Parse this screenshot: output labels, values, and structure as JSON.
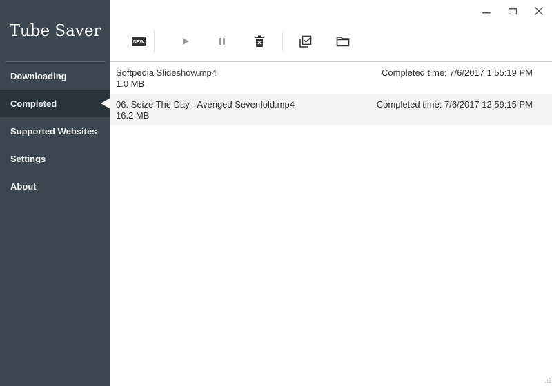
{
  "app": {
    "title": "Tube Saver"
  },
  "window_controls": {
    "minimize": "minimize",
    "maximize": "maximize",
    "close": "close"
  },
  "sidebar": {
    "active": "Completed",
    "items": [
      {
        "label": "Downloading"
      },
      {
        "label": "Completed"
      },
      {
        "label": "Supported Websites"
      },
      {
        "label": "Settings"
      },
      {
        "label": "About"
      }
    ]
  },
  "toolbar": {
    "buttons": [
      {
        "name": "new",
        "icon": "new-badge-icon",
        "label": "NEW",
        "enabled": true
      },
      {
        "name": "start",
        "icon": "play-icon",
        "enabled": false
      },
      {
        "name": "pause",
        "icon": "pause-icon",
        "enabled": false
      },
      {
        "name": "delete",
        "icon": "trash-icon",
        "enabled": true
      },
      {
        "name": "select-all",
        "icon": "select-all-icon",
        "enabled": true
      },
      {
        "name": "open-folder",
        "icon": "folder-icon",
        "enabled": true
      }
    ]
  },
  "downloads": [
    {
      "name": "Softpedia Slideshow.mp4",
      "size": "1.0 MB",
      "completed_time": "Completed time: 7/6/2017 1:55:19 PM"
    },
    {
      "name": "06. Seize The Day - Avenged Sevenfold.mp4",
      "size": "16.2 MB",
      "completed_time": "Completed time: 7/6/2017 12:59:15 PM"
    }
  ],
  "colors": {
    "sidebar_bg": "#3b4650",
    "sidebar_active": "#2a323a",
    "row_alt": "#f3f3f3"
  }
}
